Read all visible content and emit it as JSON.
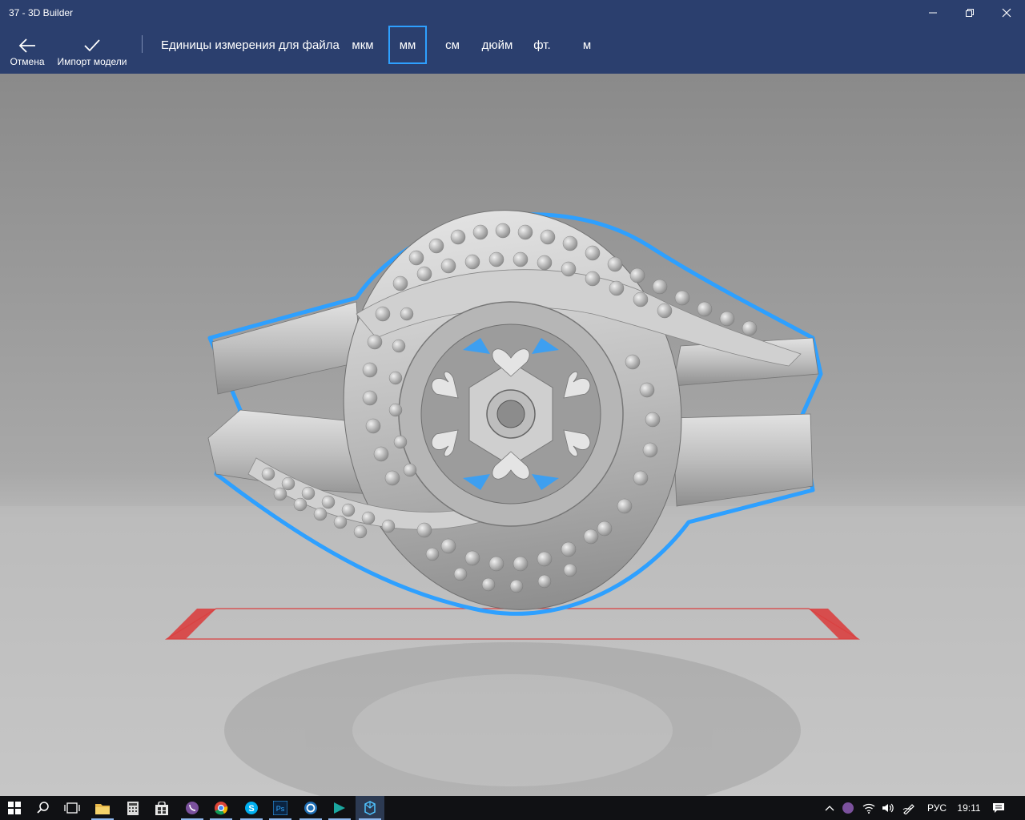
{
  "window": {
    "title": "37 - 3D Builder"
  },
  "toolbar": {
    "cancel_label": "Отмена",
    "import_label": "Импорт модели",
    "units_label": "Единицы измерения для файла",
    "units": [
      "мкм",
      "мм",
      "см",
      "дюйм",
      "фт.",
      "м"
    ],
    "selected_unit": "мм"
  },
  "colors": {
    "chrome": "#2b3f6e",
    "selection_outline": "#2ea0ff",
    "build_plate_edge": "#d94040",
    "model": "#c9c9c9"
  },
  "taskbar": {
    "icons": [
      "windows-start",
      "search",
      "task-view",
      "file-explorer",
      "calculator",
      "store",
      "viber",
      "chrome",
      "skype",
      "photoshop",
      "app-blue-circle",
      "app-teal",
      "3d-builder"
    ],
    "language": "РУС",
    "time": "19:11"
  }
}
